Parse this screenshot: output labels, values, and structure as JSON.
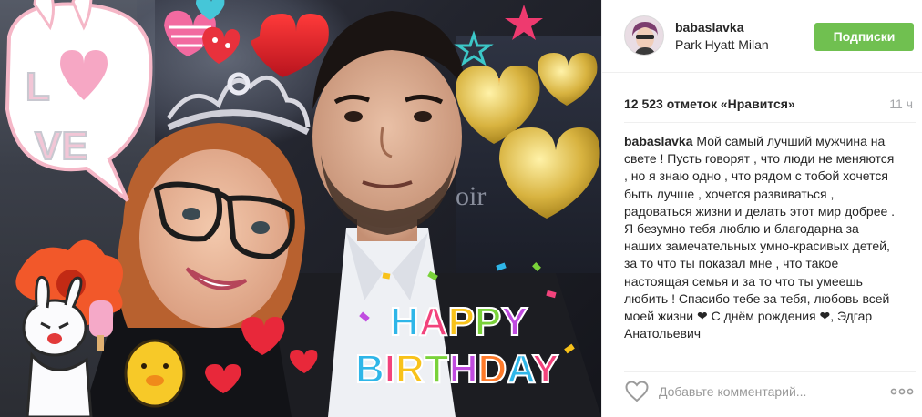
{
  "post": {
    "username": "babaslavka",
    "location": "Park Hyatt Milan",
    "follow_label": "Подписки",
    "likes": "12 523 отметок «Нравится»",
    "time": "11 ч",
    "caption_user": "babaslavka",
    "caption_text": "Мой самый лучший мужчина на свете ! Пусть говорят , что люди не меняются , но я знаю одно , что рядом с тобой хочется быть лучше , хочется развиваться , радоваться жизни и делать этот мир добрее . Я безумно тебя люблю и благодарна за наших замечательных умно-красивых детей, за то что ты показал мне , что такое настоящая семья и за то что ты умеешь любить ! Спасибо тебе за тебя, любовь всей моей жизни ❤ С днём рождения ❤, Эдгар Анатольевич",
    "comment_placeholder": "Добавьте комментарий..."
  },
  "photo": {
    "sticker_love": [
      "L",
      "VE"
    ],
    "sticker_birthday_line1": "HAPPY",
    "sticker_birthday_line2": "BIRTHDAY",
    "sign_text": "oir",
    "birthday_colors": [
      "#2fb6e8",
      "#f2437c",
      "#f8c21a",
      "#7ad23a",
      "#c04be0",
      "#ff7a2a"
    ]
  },
  "colors": {
    "follow_green": "#70c050",
    "text": "#262626",
    "muted": "#a5a7aa"
  },
  "icons": {
    "like": "heart-outline-icon",
    "more": "ellipsis-icon"
  }
}
